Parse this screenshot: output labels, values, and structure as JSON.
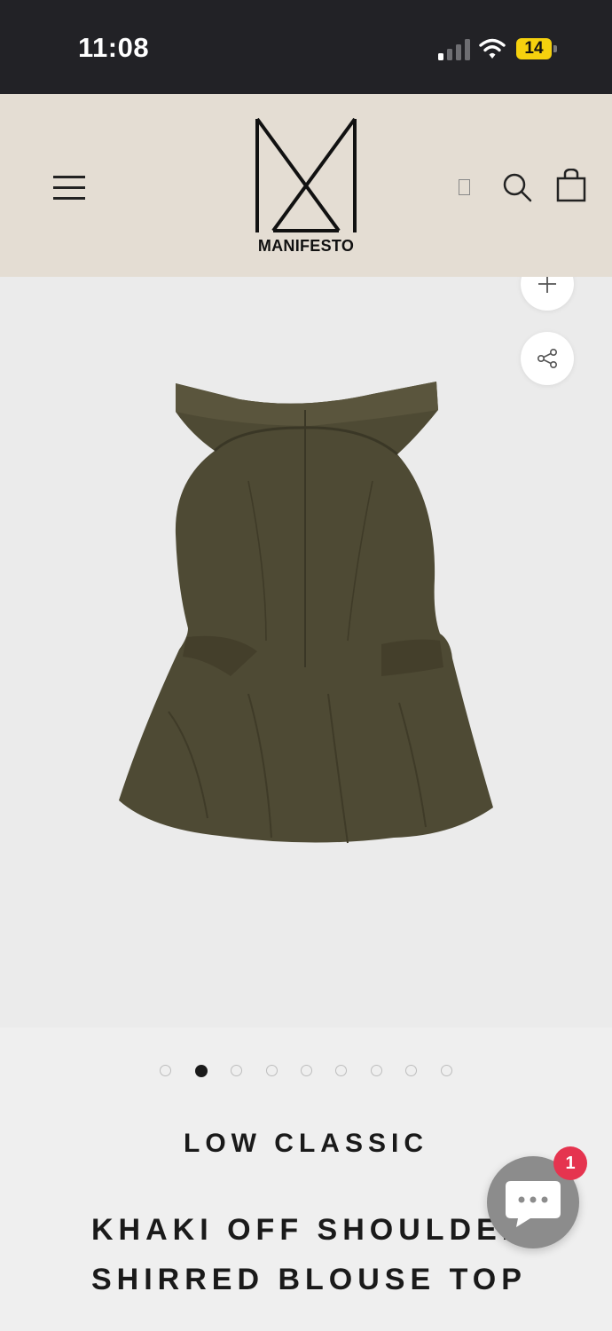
{
  "status_bar": {
    "time": "11:08",
    "battery": "14",
    "signal_icon": "cellular-signal-icon",
    "wifi_icon": "wifi-icon"
  },
  "header": {
    "logo_text": "MANIFESTO",
    "menu_icon": "hamburger-menu-icon",
    "search_icon": "search-icon",
    "cart_icon": "shopping-bag-icon"
  },
  "gallery": {
    "zoom_icon": "plus-icon",
    "share_icon": "share-icon",
    "image_count": 9,
    "active_index": 1
  },
  "product": {
    "brand": "LOW CLASSIC",
    "title": "KHAKI OFF SHOULDER SHIRRED BLOUSE TOP"
  },
  "chat": {
    "badge": "1",
    "icon": "chat-bubble-icon"
  },
  "colors": {
    "header_bg": "#e4ddd3",
    "status_bg": "#222226",
    "product_khaki": "#4e4a34",
    "badge_red": "#e5344f"
  }
}
